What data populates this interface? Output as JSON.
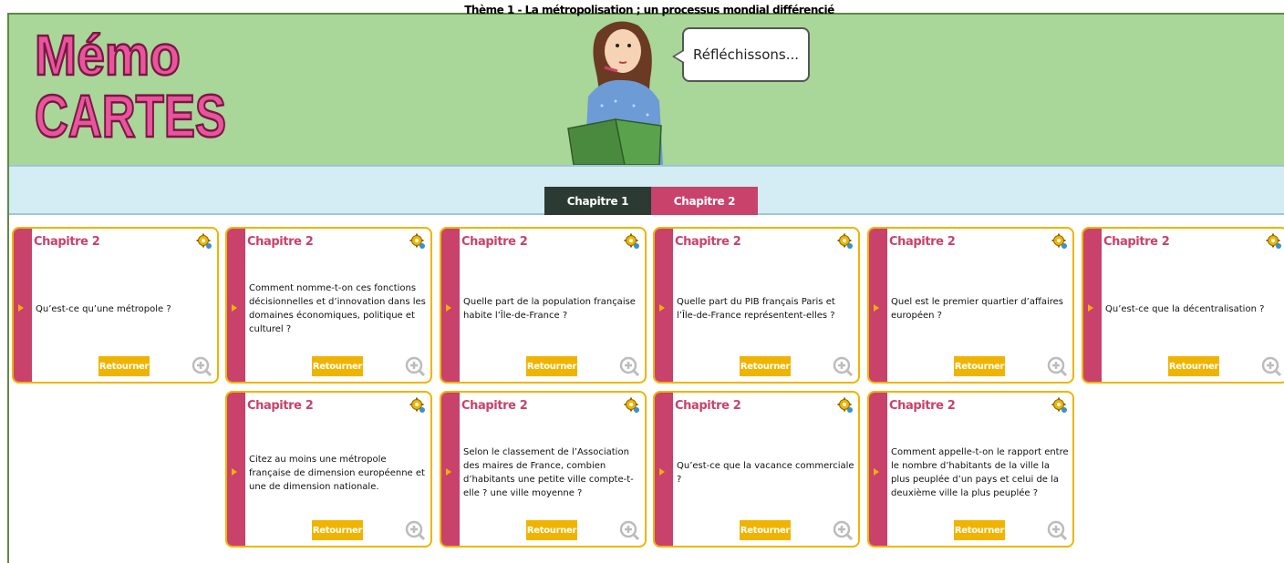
{
  "logo": {
    "line1": "Mémo",
    "line2": "CARTES"
  },
  "bubble": {
    "text": "Réfléchissons..."
  },
  "theme": {
    "title": "Thème 1 - La métropolisation ; un processus mondial différencié"
  },
  "tabs": [
    {
      "label": "Chapitre 1"
    },
    {
      "label": "Chapitre 2"
    }
  ],
  "colors": {
    "header_bg": "#a9d699",
    "theme_bg": "#d4ecf3",
    "accent_pink": "#c9426b",
    "accent_gold": "#f0b400",
    "tab_dark": "#2b3b33"
  },
  "cards": [
    {
      "chapter": "Chapitre 2",
      "question": "Qu’est-ce qu’une métropole ?",
      "button": "Retourner"
    },
    {
      "chapter": "Chapitre 2",
      "question": "Comment nomme-t-on ces fonctions décisionnelles et d’innovation dans les domaines économiques, politique et culturel ?",
      "button": "Retourner"
    },
    {
      "chapter": "Chapitre 2",
      "question": "Quelle part de la population française habite l’Île-de-France ?",
      "button": "Retourner"
    },
    {
      "chapter": "Chapitre 2",
      "question": "Quelle part du PIB français Paris et l’Île-de-France représentent-elles ?",
      "button": "Retourner"
    },
    {
      "chapter": "Chapitre 2",
      "question": "Quel est le premier quartier d’affaires européen ?",
      "button": "Retourner"
    },
    {
      "chapter": "Chapitre 2",
      "question": "Qu’est-ce que la décentralisation ?",
      "button": "Retourner"
    },
    {
      "chapter": "Chapitre 2",
      "question": "Citez au moins une métropole française de dimension européenne et une de dimension nationale.",
      "button": "Retourner"
    },
    {
      "chapter": "Chapitre 2",
      "question": "Selon le classement de l’Association des maires de France, combien d’habitants une petite ville compte-t-elle ? une ville moyenne ?",
      "button": "Retourner"
    },
    {
      "chapter": "Chapitre 2",
      "question": "Qu’est-ce que la vacance commerciale ?",
      "button": "Retourner"
    },
    {
      "chapter": "Chapitre 2",
      "question": "Comment appelle-t-on le rapport entre le nombre d’habitants de la ville la plus peuplée d’un pays et celui de la deuxième ville la plus peuplée ?",
      "button": "Retourner"
    }
  ]
}
